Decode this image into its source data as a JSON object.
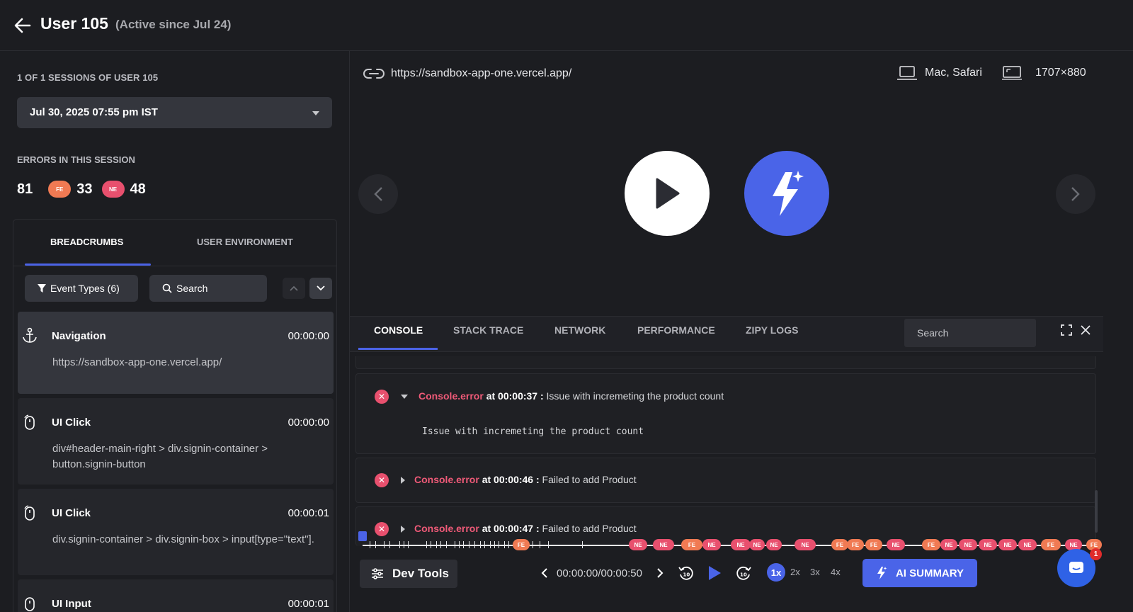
{
  "header": {
    "title": "User 105",
    "subtitle": "(Active since Jul 24)"
  },
  "sidebar": {
    "sessions_label": "1 OF 1 SESSIONS OF USER 105",
    "session_selected": "Jul 30, 2025 07:55 pm IST",
    "errors_label": "ERRORS IN THIS SESSION",
    "errors_total": "81",
    "fe_badge": "FE",
    "fe_count": "33",
    "ne_badge": "NE",
    "ne_count": "48",
    "tabs": [
      {
        "label": "BREADCRUMBS"
      },
      {
        "label": "USER ENVIRONMENT"
      }
    ],
    "event_types_label": "Event Types (6)",
    "search_label": "Search",
    "crumbs": [
      {
        "title": "Navigation",
        "time": "00:00:00",
        "desc": "https://sandbox-app-one.vercel.app/",
        "icon": "anchor-icon"
      },
      {
        "title": "UI Click",
        "time": "00:00:00",
        "desc": "div#header-main-right > div.signin-container > button.signin-button",
        "icon": "mouse-icon"
      },
      {
        "title": "UI Click",
        "time": "00:00:01",
        "desc": "div.signin-container > div.signin-box > input[type=\"text\"].",
        "icon": "mouse-icon"
      },
      {
        "title": "UI Input",
        "time": "00:00:01",
        "desc": "",
        "icon": "mouse-icon"
      }
    ]
  },
  "player": {
    "url": "https://sandbox-app-one.vercel.app/",
    "device": "Mac, Safari",
    "resolution": "1707×880"
  },
  "console": {
    "tabs": [
      {
        "label": "CONSOLE"
      },
      {
        "label": "STACK TRACE"
      },
      {
        "label": "NETWORK"
      },
      {
        "label": "PERFORMANCE"
      },
      {
        "label": "ZIPY LOGS"
      }
    ],
    "search_placeholder": "Search",
    "entries": [
      {
        "type": "Console.error",
        "at": "at",
        "time": "00:00:37 :",
        "message": "Issue with incremeting the product count",
        "detail": "Issue with incremeting the product count"
      },
      {
        "type": "Console.error",
        "at": "at",
        "time": "00:00:46 :",
        "message": "Failed to add Product"
      },
      {
        "type": "Console.error",
        "at": "at",
        "time": "00:00:47 :",
        "message": "Failed to add Product"
      }
    ]
  },
  "controls": {
    "devtools_label": "Dev Tools",
    "timecode": "00:00:00/00:00:50",
    "speeds": [
      "1x",
      "2x",
      "3x",
      "4x"
    ],
    "ai_summary_label": "AI SUMMARY",
    "chat_badge": "1",
    "timeline_fe": "FE",
    "timeline_ne": "NE"
  },
  "colors": {
    "accent": "#4a64e8",
    "fe": "#f07a53",
    "ne": "#e8506e",
    "background": "#1c1d21"
  }
}
